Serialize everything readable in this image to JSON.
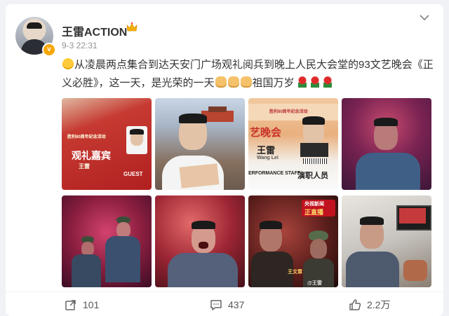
{
  "post": {
    "username": "王雷ACTION",
    "timestamp": "9-3 22:31",
    "text_main": "从凌晨两点集合到达天安门广场观礼阅兵到晚上人民大会堂的93文艺晚会《正义必胜》，这一天，是光荣的一天",
    "text_tail": "祖国万岁",
    "verified_badge": "v"
  },
  "photos": {
    "p1": {
      "title": "观礼嘉宾",
      "name": "王雷",
      "eng": "GUEST",
      "small": "胜利80周年纪念活动"
    },
    "p3": {
      "title": "艺晚会",
      "name": "王雷",
      "eng_name": "Wang Lei",
      "role_en": "ERFORMANCE STAFF",
      "role_cn": "演职人员",
      "org": "胜利80周年纪念活动"
    },
    "p7": {
      "badge_top": "央视新闻",
      "badge": "正直播",
      "name_tag": "王文章",
      "watermark": "@王雷"
    }
  },
  "actions": {
    "reposts": "101",
    "comments": "437",
    "likes": "2.2万"
  },
  "colors": {
    "accent": "#ff8200",
    "text": "#333333",
    "muted": "#939393",
    "background": "#f1f2f5"
  },
  "icons": [
    "more-icon",
    "crown-icon",
    "verified-icon",
    "repost-icon",
    "comment-icon",
    "like-icon"
  ]
}
